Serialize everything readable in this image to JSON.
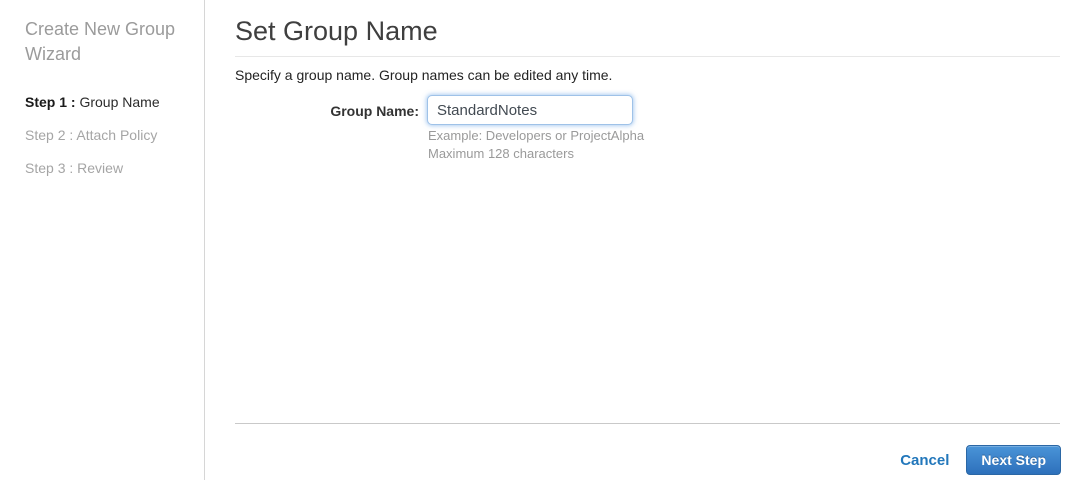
{
  "sidebar": {
    "wizard_title": "Create New Group Wizard",
    "steps": [
      {
        "prefix": "Step 1 :",
        "label": "Group Name"
      },
      {
        "prefix": "Step 2 :",
        "label": "Attach Policy"
      },
      {
        "prefix": "Step 3 :",
        "label": "Review"
      }
    ]
  },
  "main": {
    "title": "Set Group Name",
    "subtitle": "Specify a group name. Group names can be edited any time.",
    "form": {
      "group_name_label": "Group Name:",
      "group_name_value": "StandardNotes",
      "helper_example": "Example: Developers or ProjectAlpha",
      "helper_max": "Maximum 128 characters"
    },
    "footer": {
      "cancel_label": "Cancel",
      "next_label": "Next Step"
    }
  },
  "colors": {
    "accent_blue": "#2277bb",
    "button_gradient_top": "#4a94d8",
    "button_gradient_bottom": "#2d70bb",
    "inactive_step_gray": "#a5a5a5",
    "focused_input_border": "#9fc2e8"
  }
}
